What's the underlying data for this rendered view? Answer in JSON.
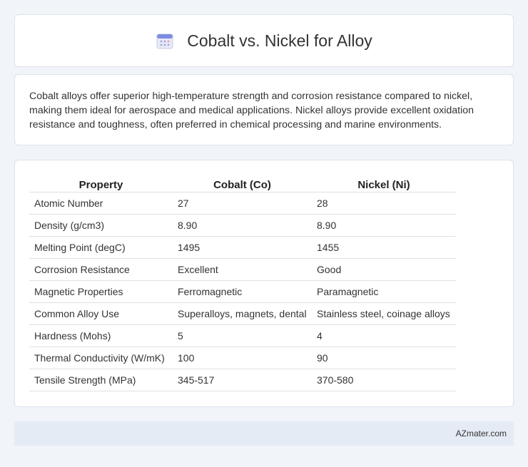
{
  "header": {
    "title": "Cobalt vs. Nickel for Alloy",
    "icon": "calendar-icon"
  },
  "intro": "Cobalt alloys offer superior high-temperature strength and corrosion resistance compared to nickel, making them ideal for aerospace and medical applications. Nickel alloys provide excellent oxidation resistance and toughness, often preferred in chemical processing and marine environments.",
  "table": {
    "headers": [
      "Property",
      "Cobalt (Co)",
      "Nickel (Ni)"
    ],
    "rows": [
      [
        "Atomic Number",
        "27",
        "28"
      ],
      [
        "Density (g/cm3)",
        "8.90",
        "8.90"
      ],
      [
        "Melting Point (degC)",
        "1495",
        "1455"
      ],
      [
        "Corrosion Resistance",
        "Excellent",
        "Good"
      ],
      [
        "Magnetic Properties",
        "Ferromagnetic",
        "Paramagnetic"
      ],
      [
        "Common Alloy Use",
        "Superalloys, magnets, dental",
        "Stainless steel, coinage alloys"
      ],
      [
        "Hardness (Mohs)",
        "5",
        "4"
      ],
      [
        "Thermal Conductivity (W/mK)",
        "100",
        "90"
      ],
      [
        "Tensile Strength (MPa)",
        "345-517",
        "370-580"
      ]
    ]
  },
  "footer": {
    "brand": "AZmater.com"
  }
}
